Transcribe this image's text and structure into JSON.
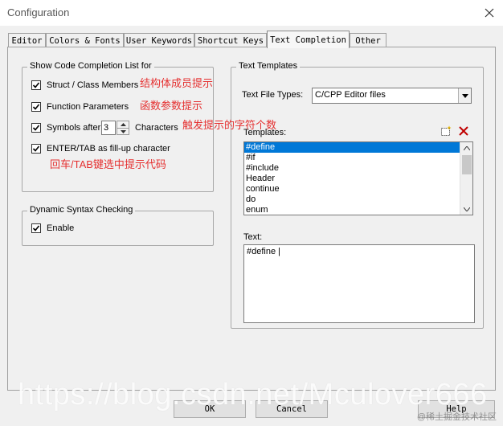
{
  "window": {
    "title": "Configuration"
  },
  "tabs": [
    {
      "label": "Editor"
    },
    {
      "label": "Colors & Fonts"
    },
    {
      "label": "User Keywords"
    },
    {
      "label": "Shortcut Keys"
    },
    {
      "label": "Text Completion"
    },
    {
      "label": "Other"
    }
  ],
  "completion_group": {
    "title": "Show Code Completion List for",
    "struct_members": {
      "label": "Struct / Class Members",
      "checked": true
    },
    "function_params": {
      "label": "Function Parameters",
      "checked": true
    },
    "symbols_after": {
      "label": "Symbols after",
      "value": "3",
      "suffix": "Characters",
      "checked": true
    },
    "enter_tab": {
      "label": "ENTER/TAB as fill-up character",
      "checked": true
    }
  },
  "syntax_group": {
    "title": "Dynamic Syntax Checking",
    "enable": {
      "label": "Enable",
      "checked": true
    }
  },
  "templates_group": {
    "title": "Text Templates",
    "file_types_label": "Text File Types:",
    "file_types_value": "C/CPP Editor files",
    "templates_label": "Templates:",
    "templates": [
      "#define",
      "#if",
      "#include",
      "Header",
      "continue",
      "do",
      "enum"
    ],
    "selected_index": 0,
    "text_label": "Text:",
    "text_value": "#define |"
  },
  "annotations": {
    "struct": "结构体成员提示",
    "func": "函数参数提示",
    "symbols": "触发提示的字符个数",
    "enter": "回车/TAB键选中提示代码"
  },
  "buttons": {
    "ok": "OK",
    "cancel": "Cancel",
    "help": "Help"
  },
  "watermark": {
    "main": "https://blog.csdn.net/Mculover666",
    "corner": "@稀土掘金技术社区"
  },
  "colors": {
    "annotation": "#e53030",
    "selection": "#0078d7",
    "background": "#f0f0f0"
  }
}
